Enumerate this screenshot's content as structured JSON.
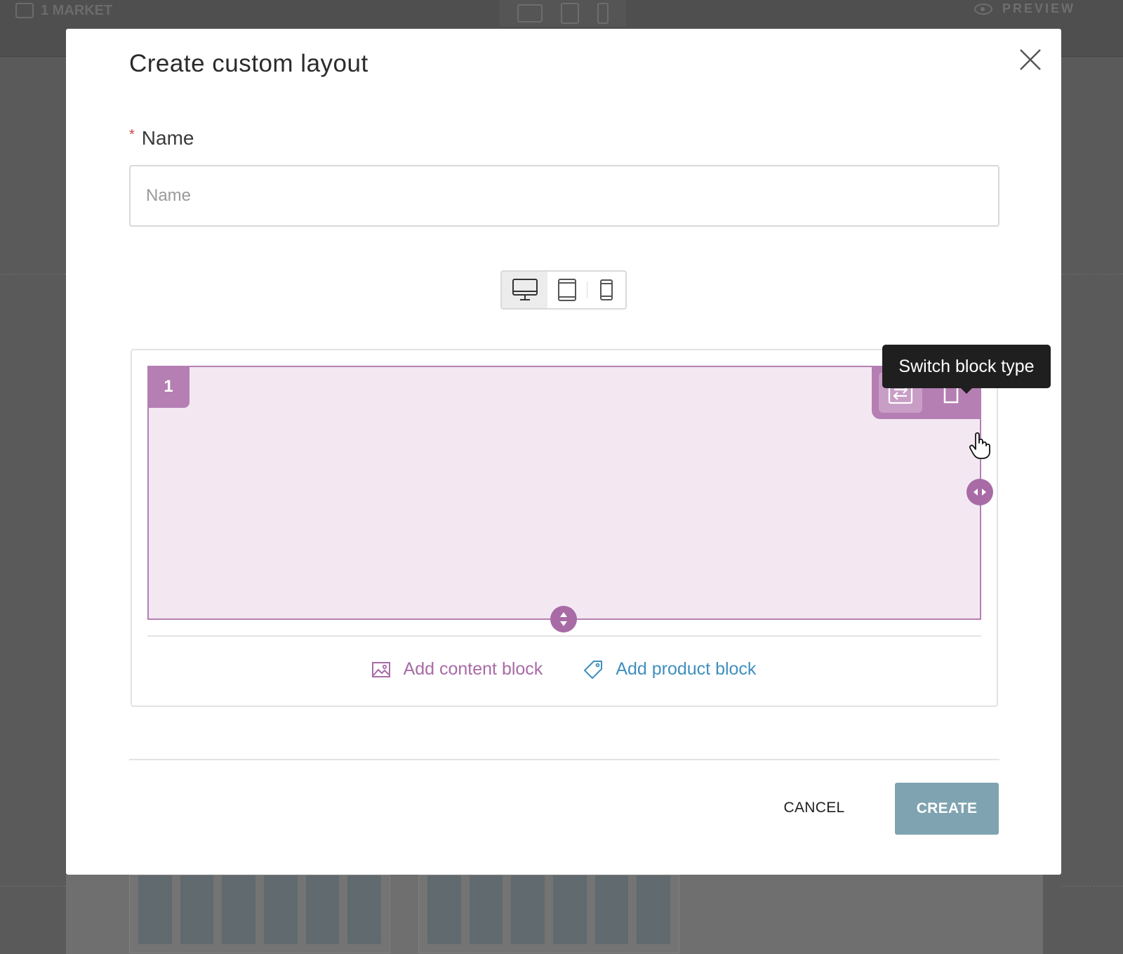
{
  "background": {
    "market_label": "1 MARKET",
    "preview_label": "PREVIEW"
  },
  "modal": {
    "title": "Create custom layout",
    "name_field": {
      "label": "Name",
      "required_marker": "*",
      "placeholder": "Name",
      "value": ""
    },
    "device_switch": {
      "options": [
        "desktop",
        "tablet",
        "mobile"
      ],
      "selected": "desktop"
    },
    "layout_block": {
      "number": "1",
      "tooltip": "Switch block type",
      "color": "#b57fb3",
      "fill_color": "#f3e8f2"
    },
    "add_content_label": "Add content block",
    "add_product_label": "Add product block",
    "cancel_label": "CANCEL",
    "create_label": "CREATE",
    "colors": {
      "content_accent": "#a86ba6",
      "product_accent": "#3f8fbf",
      "create_button": "#7fa3b0"
    }
  }
}
